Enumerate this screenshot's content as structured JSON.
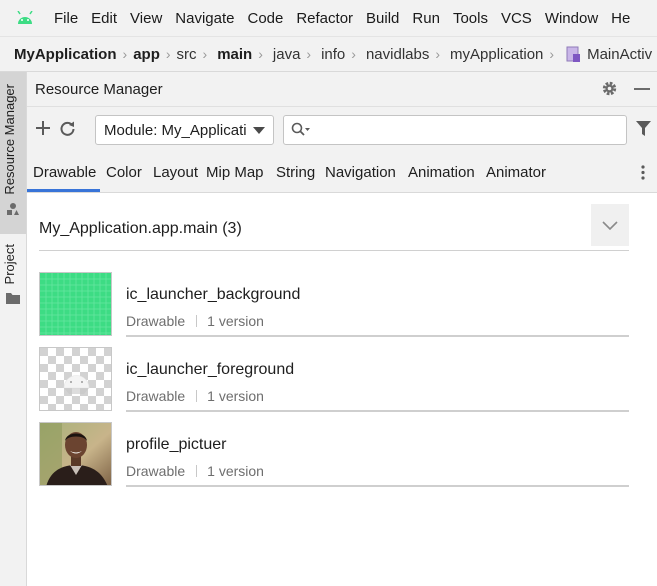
{
  "menu": [
    "File",
    "Edit",
    "View",
    "Navigate",
    "Code",
    "Refactor",
    "Build",
    "Run",
    "Tools",
    "VCS",
    "Window",
    "He"
  ],
  "breadcrumb": [
    {
      "label": "MyApplication",
      "bold": true
    },
    {
      "label": "app",
      "bold": true
    },
    {
      "label": "src",
      "bold": false
    },
    {
      "label": "main",
      "bold": true
    },
    {
      "label": "java",
      "bold": false
    },
    {
      "label": "info",
      "bold": false
    },
    {
      "label": "navidlabs",
      "bold": false
    },
    {
      "label": "myApplication",
      "bold": false
    },
    {
      "label": "MainActiv",
      "bold": false,
      "icon": "kotlin-file-icon"
    }
  ],
  "side_tabs": {
    "resource_manager": "Resource Manager",
    "project": "Project"
  },
  "panel": {
    "title": "Resource Manager"
  },
  "toolbar": {
    "module_value": "Module: My_Applicati",
    "search_value": "",
    "search_placeholder": ""
  },
  "tabs": [
    "Drawable",
    "Color",
    "Layout",
    "Mip Map",
    "String",
    "Navigation",
    "Animation",
    "Animator"
  ],
  "active_tab": "Drawable",
  "group": {
    "title": "My_Application.app.main (3)"
  },
  "resources": [
    {
      "name": "ic_launcher_background",
      "type": "Drawable",
      "versions": "1 version",
      "thumb": "green-grid"
    },
    {
      "name": "ic_launcher_foreground",
      "type": "Drawable",
      "versions": "1 version",
      "thumb": "android-head-on-checker"
    },
    {
      "name": "profile_pictuer",
      "type": "Drawable",
      "versions": "1 version",
      "thumb": "portrait-photo"
    }
  ],
  "colors": {
    "accent": "#3874d8",
    "android_green": "#3ddc84",
    "launcher_bg": "#3ddc84"
  }
}
